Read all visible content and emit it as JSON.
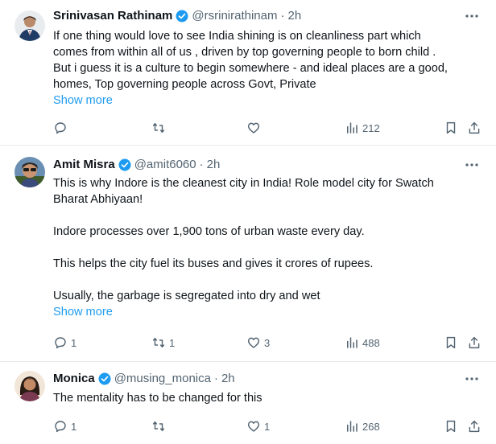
{
  "tweets": [
    {
      "name": "Srinivasan Rathinam",
      "handle": "@rsrinirathinam",
      "sep": "·",
      "time": "2h",
      "text": "If one thing would love to see India shining is on cleanliness part which\ncomes from within all of us , driven by top governing people to born child .\nBut i guess it is a culture to begin somewhere - and ideal places are a good,\nhomes, Top governing people across Govt, Private",
      "show_more": "Show more",
      "counts": {
        "replies": "",
        "reposts": "",
        "likes": "",
        "views": "212"
      }
    },
    {
      "name": "Amit Misra",
      "handle": "@amit6060",
      "sep": "·",
      "time": "2h",
      "paragraphs": [
        "This is why Indore is the cleanest city in India! Role model city for Swatch\nBharat Abhiyaan!",
        "Indore processes over 1,900 tons of urban waste every day.",
        "This helps the city fuel its buses and gives it crores of rupees.",
        "Usually, the garbage is segregated into dry and wet"
      ],
      "show_more": "Show more",
      "counts": {
        "replies": "1",
        "reposts": "1",
        "likes": "3",
        "views": "488"
      }
    },
    {
      "name": "Monica",
      "handle": "@musing_monica",
      "sep": "·",
      "time": "2h",
      "text": "The mentality has to be changed for this",
      "counts": {
        "replies": "1",
        "reposts": "",
        "likes": "1",
        "views": "268"
      }
    }
  ],
  "colors": {
    "accent": "#1d9bf0",
    "muted": "#536471",
    "text": "#0f1419"
  },
  "icons": [
    "verified-badge-icon",
    "more-options-icon",
    "reply-icon",
    "repost-icon",
    "like-icon",
    "views-icon",
    "bookmark-icon",
    "share-icon"
  ]
}
